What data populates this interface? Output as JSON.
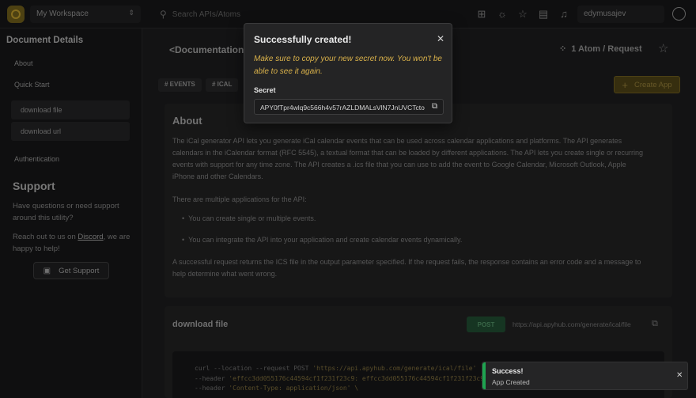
{
  "topbar": {
    "workspace": "My Workspace",
    "search_placeholder": "Search APIs/Atoms",
    "username": "edymusajev"
  },
  "sidebar": {
    "title": "Document Details",
    "items": [
      {
        "label": "About"
      },
      {
        "label": "Quick Start"
      },
      {
        "label": "download file"
      },
      {
        "label": "download url"
      },
      {
        "label": "Authentication"
      }
    ],
    "support": {
      "title": "Support",
      "text1": "Have questions or need support around this utility?",
      "text2_prefix": "Reach out to us on ",
      "text2_link": "Discord",
      "text2_suffix": ", we are happy to help!",
      "button": "Get Support"
    }
  },
  "main": {
    "title": "<Documentation",
    "badge": "1 Atom / Request",
    "tags": [
      "# EVENTS",
      "# ICAL"
    ],
    "create_button": "Create App",
    "about": {
      "heading": "About",
      "p1": "The iCal generator API lets you generate iCal calendar events that can be used across calendar applications and platforms. The API generates calendars in the iCalendar format (RFC 5545), a textual format that can be loaded by different applications. The API lets you create single or recurring events with support for any time zone. The API creates a .ics file that you can use to add the event to Google Calendar, Microsoft Outlook, Apple iPhone and other Calendars.",
      "p2": "There are multiple applications for the API:",
      "li1": "You can create single or multiple events.",
      "li2": "You can integrate the API into your application and create calendar events dynamically.",
      "p3": "A successful request returns the ICS file in the output parameter specified. If the request fails, the response contains an error code and a message to help determine what went wrong."
    },
    "download": {
      "title": "download file",
      "method": "POST",
      "endpoint": "https://api.apyhub.com/generate/ical/file",
      "code_line1_cmd": "curl --location --request POST ",
      "code_line1_str": "'https://api.apyhub.com/generate/ical/file'",
      "code_line2_cmd": "--header ",
      "code_line2_str": "'effcc3dd055176c44594cf1f231f23c9: effcc3dd055176c44594cf1f231f23c9'",
      "code_line3_cmd": "--header ",
      "code_line3_str": "'Content-Type: application/json' \\"
    }
  },
  "modal": {
    "title": "Successfully created!",
    "warning": "Make sure to copy your new secret now. You won't be able to see it again.",
    "secret_label": "Secret",
    "secret_value": "APY0fTpr4wlq9c566h4v57rAZLDMALsVlN7JnUVCTcto"
  },
  "toast": {
    "title": "Success!",
    "message": "App Created"
  }
}
